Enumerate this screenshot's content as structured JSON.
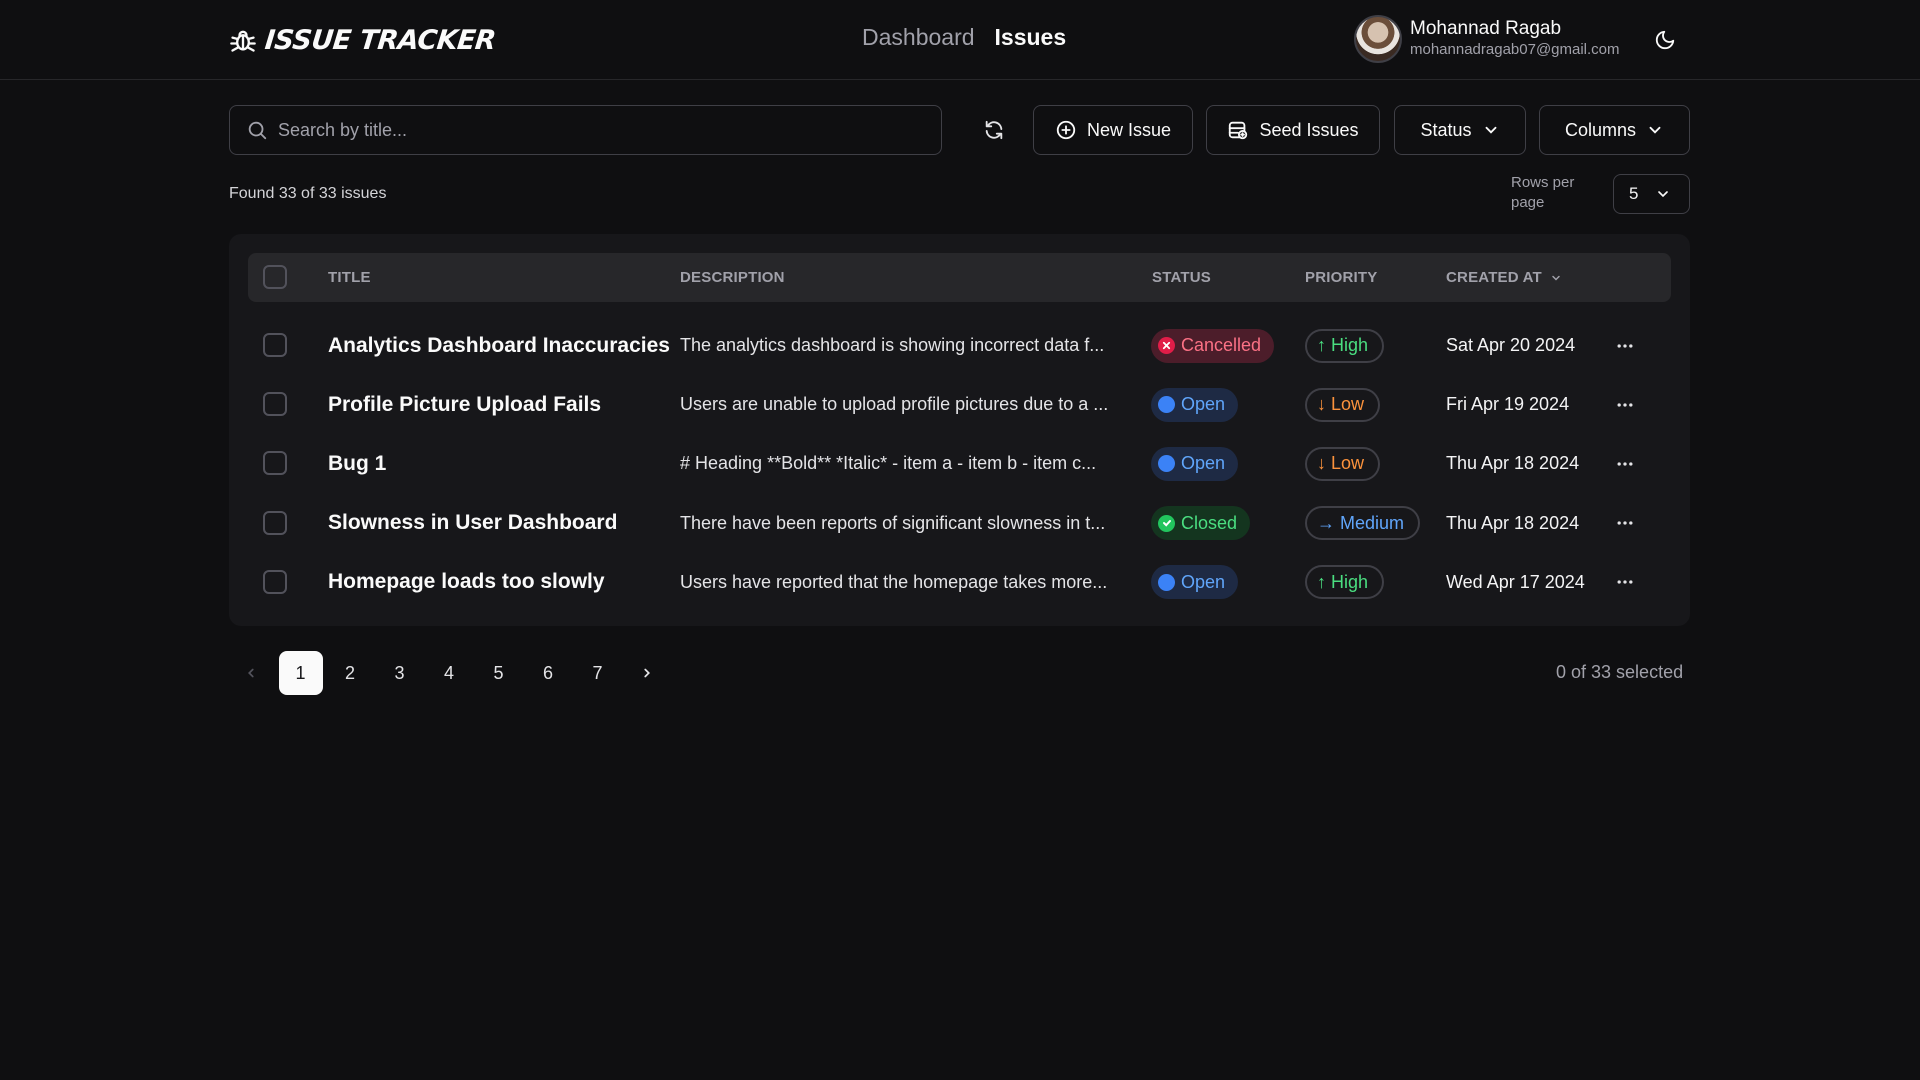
{
  "app": {
    "logo_text": "ISSUE TRACKER",
    "nav": [
      {
        "label": "Dashboard",
        "active": false
      },
      {
        "label": "Issues",
        "active": true
      }
    ],
    "user": {
      "name": "Mohannad Ragab",
      "email": "mohannadragab07@gmail.com"
    },
    "theme_icon": "moon-icon"
  },
  "toolbar": {
    "search_placeholder": "Search by title...",
    "new_issue_label": "New Issue",
    "seed_issues_label": "Seed Issues",
    "status_label": "Status",
    "columns_label": "Columns"
  },
  "summary": {
    "found_text": "Found 33 of 33 issues",
    "rows_per_page_label": "Rows per page",
    "rows_per_page_value": "5"
  },
  "table": {
    "headers": {
      "title": "TITLE",
      "description": "DESCRIPTION",
      "status": "STATUS",
      "priority": "PRIORITY",
      "created_at": "CREATED AT"
    },
    "rows": [
      {
        "title": "Analytics Dashboard Inaccuracies",
        "description": "The analytics dashboard is showing incorrect data f...",
        "status": "Cancelled",
        "priority": "High",
        "created_at": "Sat Apr 20 2024"
      },
      {
        "title": "Profile Picture Upload Fails",
        "description": "Users are unable to upload profile pictures due to a ...",
        "status": "Open",
        "priority": "Low",
        "created_at": "Fri Apr 19 2024"
      },
      {
        "title": "Bug 1",
        "description": "# Heading **Bold** *Italic* - item a - item b - item c...",
        "status": "Open",
        "priority": "Low",
        "created_at": "Thu Apr 18 2024"
      },
      {
        "title": "Slowness in User Dashboard",
        "description": "There have been reports of significant slowness in t...",
        "status": "Closed",
        "priority": "Medium",
        "created_at": "Thu Apr 18 2024"
      },
      {
        "title": "Homepage loads too slowly",
        "description": "Users have reported that the homepage takes more...",
        "status": "Open",
        "priority": "High",
        "created_at": "Wed Apr 17 2024"
      }
    ]
  },
  "status_styles": {
    "Cancelled": {
      "bg": "#4c1d2a",
      "fg": "#fb7185",
      "dot": "#e11d48",
      "icon": "x-circle-icon"
    },
    "Open": {
      "bg": "#1e2a44",
      "fg": "#60a5fa",
      "dot": "#3b82f6",
      "icon": "circle-icon"
    },
    "Closed": {
      "bg": "#14351f",
      "fg": "#4ade80",
      "dot": "#22c55e",
      "icon": "check-circle-icon"
    }
  },
  "priority_styles": {
    "High": {
      "fg": "#4ade80",
      "arrow": "↑",
      "icon": "arrow-up-icon"
    },
    "Low": {
      "fg": "#fb923c",
      "arrow": "↓",
      "icon": "arrow-down-icon"
    },
    "Medium": {
      "fg": "#60a5fa",
      "arrow": "→",
      "icon": "arrow-right-icon"
    }
  },
  "pagination": {
    "pages": [
      "1",
      "2",
      "3",
      "4",
      "5",
      "6",
      "7"
    ],
    "current": "1",
    "selected_text": "0 of 33 selected"
  }
}
